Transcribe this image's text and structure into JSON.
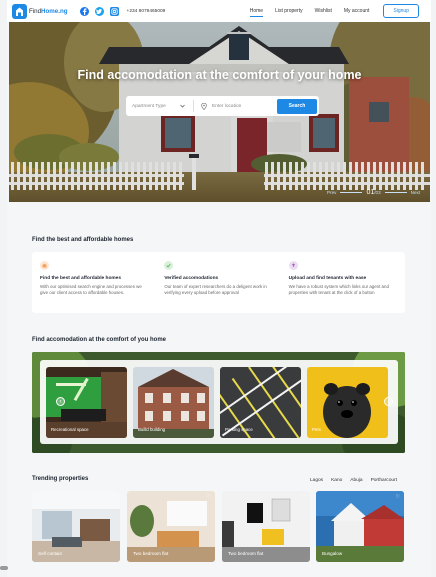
{
  "header": {
    "logo_prefix": "Find",
    "logo_brand": "Home.ng",
    "phone": "+234 8079465009",
    "nav": [
      "Home",
      "List property",
      "Wishlist",
      "My account"
    ],
    "signup": "Signup"
  },
  "hero": {
    "title": "Find accomodation at the comfort of your home",
    "search": {
      "type_placeholder": "Apartment Type",
      "location_placeholder": "Enter location",
      "button": "Search"
    },
    "pager": {
      "prev": "Prev",
      "current": "01",
      "total": "/03",
      "next": "Next"
    }
  },
  "features_section": {
    "title": "Find the best and affordable homes",
    "items": [
      {
        "title": "Find the best and affordable homes",
        "desc": "With our optimised search engine and processes we give our client access to affordable houses.",
        "icon": "home-icon",
        "color": "#f4a261"
      },
      {
        "title": "Verified accomodations",
        "desc": "Our team of expert researchers do a deligent work in verifying every upload before approval",
        "icon": "check-icon",
        "color": "#5cb85c"
      },
      {
        "title": "Upload and find tenants with ease",
        "desc": "We have a robust system which links our agent and properties with tenant at the click of a button",
        "icon": "upload-icon",
        "color": "#9b59b6"
      }
    ]
  },
  "types_section": {
    "title": "Find accomodation at the comfort of you home",
    "cards": [
      "Recreational space",
      "Builld building",
      "Parking space",
      "Pets"
    ]
  },
  "trending": {
    "title": "Trending properties",
    "cities": [
      "Lagos",
      "Kano",
      "Abuja",
      "Portharcourt"
    ],
    "properties": [
      "Self contain",
      "Two bedroom flat",
      "Two bedroom flat",
      "Bungalow"
    ]
  },
  "colors": {
    "accent": "#1e88e5",
    "text": "#1c2430"
  }
}
